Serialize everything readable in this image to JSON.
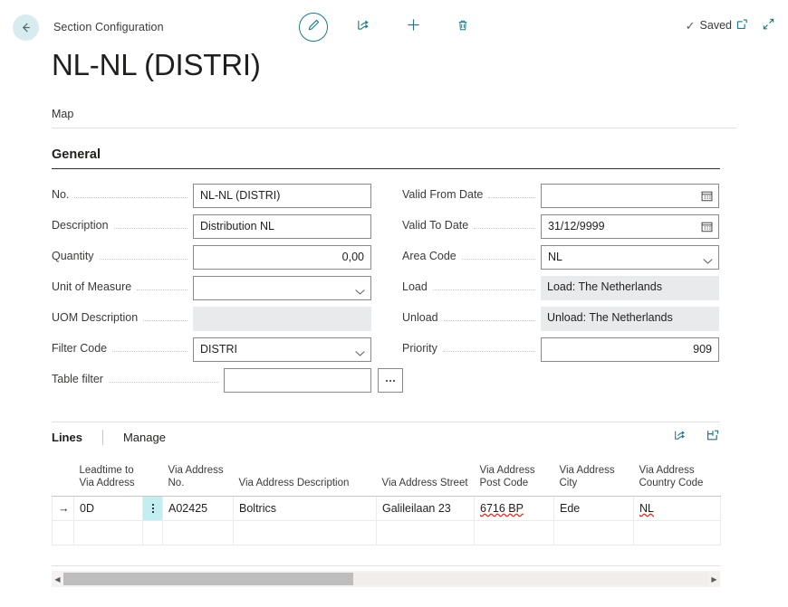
{
  "topbar": {
    "back_icon": "back-arrow-icon",
    "breadcrumb": "Section Configuration",
    "commands": [
      {
        "name": "edit-button",
        "icon": "pencil-icon"
      },
      {
        "name": "share-button",
        "icon": "share-icon"
      },
      {
        "name": "new-button",
        "icon": "plus-icon"
      },
      {
        "name": "delete-button",
        "icon": "trash-icon"
      }
    ],
    "status_text": "Saved",
    "status_icon": "checkmark-icon",
    "open_new_window_icon": "open-in-new-window-icon",
    "fullscreen_icon": "expand-diagonal-icon"
  },
  "page_title": "NL-NL (DISTRI)",
  "tabs": [
    {
      "label": "Map"
    }
  ],
  "general": {
    "heading": "General",
    "left_fields": [
      {
        "label": "No.",
        "value": "NL-NL (DISTRI)",
        "type": "text"
      },
      {
        "label": "Description",
        "value": "Distribution NL",
        "type": "text"
      },
      {
        "label": "Quantity",
        "value": "0,00",
        "type": "number"
      },
      {
        "label": "Unit of Measure",
        "value": "",
        "type": "dropdown"
      },
      {
        "label": "UOM Description",
        "value": "",
        "type": "disabled"
      },
      {
        "label": "Filter Code",
        "value": "DISTRI",
        "type": "dropdown"
      },
      {
        "label": "Table filter",
        "value": "",
        "type": "lookup"
      }
    ],
    "right_fields": [
      {
        "label": "Valid From Date",
        "value": "",
        "type": "date"
      },
      {
        "label": "Valid To Date",
        "value": "31/12/9999",
        "type": "date"
      },
      {
        "label": "Area Code",
        "value": "NL",
        "type": "dropdown"
      },
      {
        "label": "Load",
        "value": "Load: The Netherlands",
        "type": "flat"
      },
      {
        "label": "Unload",
        "value": "Unload: The Netherlands",
        "type": "flat"
      },
      {
        "label": "Priority",
        "value": "909",
        "type": "number"
      }
    ]
  },
  "lines": {
    "tab_label": "Lines",
    "manage_label": "Manage",
    "share_icon": "share-icon",
    "open_excel_icon": "open-in-excel-icon",
    "columns": [
      "Leadtime to Via Address",
      "Via Address No.",
      "Via Address Description",
      "Via Address Street",
      "Via Address Post Code",
      "Via Address City",
      "Via Address Country Code"
    ],
    "rows": [
      {
        "selected": true,
        "row_indicator": "→",
        "cells": [
          "0D",
          "A02425",
          "Boltrics",
          "Galileilaan 23",
          "6716 BP",
          "Ede",
          "NL"
        ],
        "spellcheck_cells": [
          4,
          6
        ]
      },
      {
        "selected": false,
        "row_indicator": "",
        "cells": [
          "",
          "",
          "",
          "",
          "",
          "",
          ""
        ],
        "spellcheck_cells": []
      }
    ]
  },
  "scrollbar": {
    "left_arrow": "◀",
    "right_arrow": "▶",
    "thumb_percent": "45"
  },
  "colors": {
    "accent_teal": "#1b7a84",
    "back_circle": "#d8ecef",
    "cell_highlight": "#c3eef1",
    "disabled_field": "#e9eaec",
    "spellcheck": "#d93025"
  }
}
